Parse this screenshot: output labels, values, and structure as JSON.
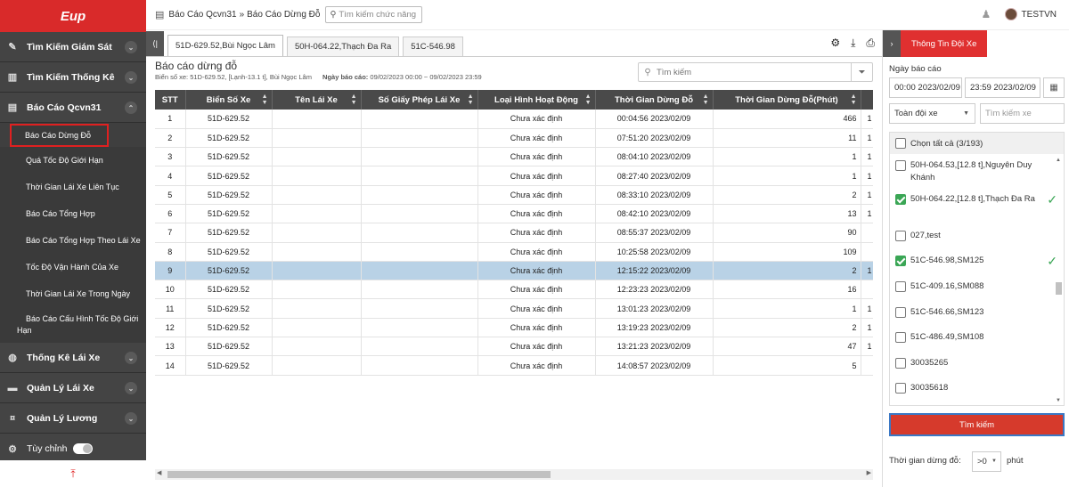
{
  "logo": {
    "text": "Eup"
  },
  "sidebar": {
    "sections_top": [
      {
        "label": "Tìm Kiếm Giám Sát",
        "icon": "pencil-icon"
      },
      {
        "label": "Tìm Kiếm Thống Kê",
        "icon": "bar-chart-icon"
      },
      {
        "label": "Báo Cáo Qcvn31",
        "icon": "report-icon"
      }
    ],
    "sub_items": [
      "Báo Cáo Dừng Đỗ",
      "Quá Tốc Độ Giới Hạn",
      "Thời Gian Lái Xe Liên Tục",
      "Báo Cáo Tổng Hợp",
      "Báo Cáo Tổng Hợp Theo Lái Xe",
      "Tốc Độ Vận Hành Của Xe",
      "Thời Gian Lái Xe Trong Ngày",
      "Báo Cáo Cấu Hình Tốc Độ Giới Hạn"
    ],
    "sections_bottom": [
      {
        "label": "Thống Kê Lái Xe",
        "icon": "driver-stats-icon"
      },
      {
        "label": "Quản Lý Lái Xe",
        "icon": "id-card-icon"
      },
      {
        "label": "Quản Lý Lương",
        "icon": "money-icon"
      }
    ],
    "custom_label": "Tùy chỉnh"
  },
  "topbar": {
    "breadcrumb_1": "Báo Cáo Qcvn31",
    "separator": "»",
    "breadcrumb_2": "Báo Cáo Dừng Đỗ",
    "search_func_placeholder": "Tìm kiếm chức năng",
    "username": "TESTVN"
  },
  "tabs": [
    {
      "label": "51D-629.52,Bùi Ngọc Lâm",
      "active": true
    },
    {
      "label": "50H-064.22,Thạch Đa Ra",
      "active": false
    },
    {
      "label": "51C-546.98",
      "active": false
    }
  ],
  "report": {
    "title": "Báo cáo dừng đỗ",
    "vehicle_text": "Biển số xe: 51D-629.52, [Lạnh-13.1 t], Bùi Ngọc Lâm",
    "date_label": "Ngày báo cáo:",
    "date_value": "09/02/2023 00:00 ~ 09/02/2023 23:59",
    "search_placeholder": "Tìm kiếm"
  },
  "table": {
    "headers": [
      "STT",
      "Biển Số Xe",
      "Tên Lái Xe",
      "Số Giấy Phép Lái Xe",
      "Loại Hình Hoạt Động",
      "Thời Gian Dừng Đỗ",
      "Thời Gian Dừng Đỗ(Phút)",
      ""
    ],
    "rows": [
      {
        "stt": "1",
        "plate": "51D-629.52",
        "type": "Chưa xác định",
        "time": "00:04:56 2023/02/09",
        "minutes": "466",
        "extra": "1"
      },
      {
        "stt": "2",
        "plate": "51D-629.52",
        "type": "Chưa xác định",
        "time": "07:51:20 2023/02/09",
        "minutes": "11",
        "extra": "1"
      },
      {
        "stt": "3",
        "plate": "51D-629.52",
        "type": "Chưa xác định",
        "time": "08:04:10 2023/02/09",
        "minutes": "1",
        "extra": "1"
      },
      {
        "stt": "4",
        "plate": "51D-629.52",
        "type": "Chưa xác định",
        "time": "08:27:40 2023/02/09",
        "minutes": "1",
        "extra": "1"
      },
      {
        "stt": "5",
        "plate": "51D-629.52",
        "type": "Chưa xác định",
        "time": "08:33:10 2023/02/09",
        "minutes": "2",
        "extra": "1"
      },
      {
        "stt": "6",
        "plate": "51D-629.52",
        "type": "Chưa xác định",
        "time": "08:42:10 2023/02/09",
        "minutes": "13",
        "extra": "1"
      },
      {
        "stt": "7",
        "plate": "51D-629.52",
        "type": "Chưa xác định",
        "time": "08:55:37 2023/02/09",
        "minutes": "90",
        "extra": ""
      },
      {
        "stt": "8",
        "plate": "51D-629.52",
        "type": "Chưa xác định",
        "time": "10:25:58 2023/02/09",
        "minutes": "109",
        "extra": ""
      },
      {
        "stt": "9",
        "plate": "51D-629.52",
        "type": "Chưa xác định",
        "time": "12:15:22 2023/02/09",
        "minutes": "2",
        "extra": "1"
      },
      {
        "stt": "10",
        "plate": "51D-629.52",
        "type": "Chưa xác định",
        "time": "12:23:23 2023/02/09",
        "minutes": "16",
        "extra": ""
      },
      {
        "stt": "11",
        "plate": "51D-629.52",
        "type": "Chưa xác định",
        "time": "13:01:23 2023/02/09",
        "minutes": "1",
        "extra": "1"
      },
      {
        "stt": "12",
        "plate": "51D-629.52",
        "type": "Chưa xác định",
        "time": "13:19:23 2023/02/09",
        "minutes": "2",
        "extra": "1"
      },
      {
        "stt": "13",
        "plate": "51D-629.52",
        "type": "Chưa xác định",
        "time": "13:21:23 2023/02/09",
        "minutes": "47",
        "extra": "1"
      },
      {
        "stt": "14",
        "plate": "51D-629.52",
        "type": "Chưa xác định",
        "time": "14:08:57 2023/02/09",
        "minutes": "5",
        "extra": ""
      }
    ],
    "selected_row": 9
  },
  "right_panel": {
    "title": "Thông Tin Đội Xe",
    "date_label": "Ngày báo cáo",
    "start": "00:00 2023/02/09",
    "end": "23:59 2023/02/09",
    "fleet_select": "Toàn đội xe",
    "vehicle_placeholder": "Tìm kiếm xe",
    "select_all": "Chọn tất cả (3/193)",
    "vehicles": [
      {
        "label": "50H-064.53,[12.8 t],Nguyên Duy Khánh",
        "checked": false
      },
      {
        "label": "50H-064.22,[12.8 t],Thạch Đa Ra",
        "checked": true
      },
      {
        "label": "027,test",
        "checked": false
      },
      {
        "label": "51C-546.98,SM125",
        "checked": true
      },
      {
        "label": "51C-409.16,SM088",
        "checked": false
      },
      {
        "label": "51C-546.66,SM123",
        "checked": false
      },
      {
        "label": "51C-486.49,SM108",
        "checked": false
      },
      {
        "label": "30035265",
        "checked": false
      },
      {
        "label": "30035618",
        "checked": false
      }
    ],
    "search_button": "Tìm kiếm",
    "stop_time_label": "Thời gian dừng đỗ:",
    "stop_time_value": ">0",
    "stop_time_unit": "phút"
  },
  "colors": {
    "brand_red": "#d92a2a",
    "sidebar_bg": "#3f3f3f",
    "header_dark": "#4a4a4a",
    "selected_row": "#b9d2e6",
    "check_green": "#3aa655"
  }
}
